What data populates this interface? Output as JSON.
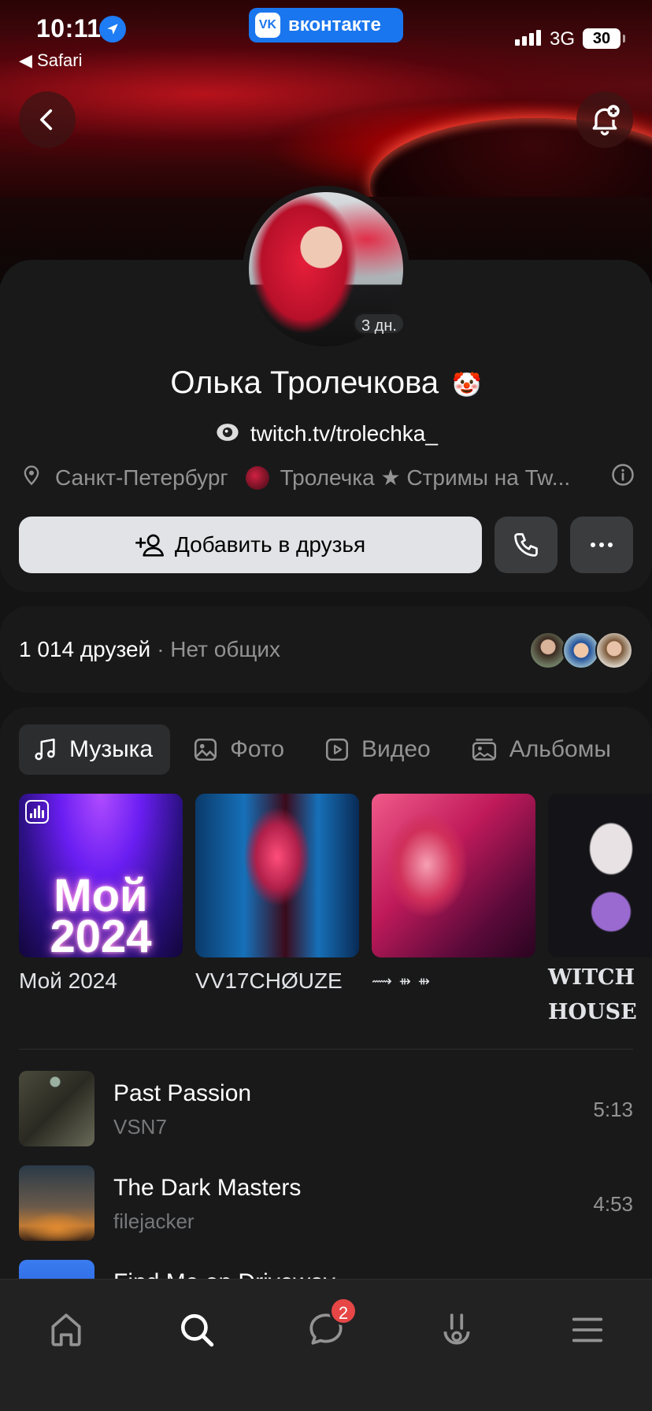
{
  "status_bar": {
    "time": "10:11",
    "back_app": "◀ Safari",
    "network": "3G",
    "battery": "30"
  },
  "app_pill": {
    "label": "вконтакте"
  },
  "profile": {
    "name": "Олька Тролечкова",
    "name_emoji": "🤡",
    "online_badge": "3 дн.",
    "link": "twitch.tv/trolechka_",
    "city": "Санкт-Петербург",
    "group": "Тролечка ★ Стримы на Tw..."
  },
  "actions": {
    "add_friend": "Добавить в друзья"
  },
  "friends": {
    "count": "1 014 друзей",
    "mutual": "· Нет общих"
  },
  "media_tabs": [
    {
      "label": "Музыка",
      "icon": "music-note-icon",
      "active": true
    },
    {
      "label": "Фото",
      "icon": "photo-icon",
      "active": false
    },
    {
      "label": "Видео",
      "icon": "video-icon",
      "active": false
    },
    {
      "label": "Альбомы",
      "icon": "albums-icon",
      "active": false
    }
  ],
  "playlists": [
    {
      "title": "Мой 2024",
      "cover_text": "Мой 2024"
    },
    {
      "title": "VV17CHØUZE"
    },
    {
      "title": "⟿ ⇻ ⇻"
    },
    {
      "title": "WITCH HOUSE"
    }
  ],
  "tracks": [
    {
      "title": "Past Passion",
      "artist": "VSN7",
      "duration": "5:13"
    },
    {
      "title": "The Dark Masters",
      "artist": "filejacker",
      "duration": "4:53"
    },
    {
      "title": "Find Me on Driveway",
      "artist": "",
      "duration": ""
    }
  ],
  "tab_bar": {
    "messages_badge": "2"
  },
  "colors": {
    "background": "#141414",
    "card": "#19191a",
    "accent_blue": "#1a76ee",
    "badge_red": "#e64646"
  }
}
